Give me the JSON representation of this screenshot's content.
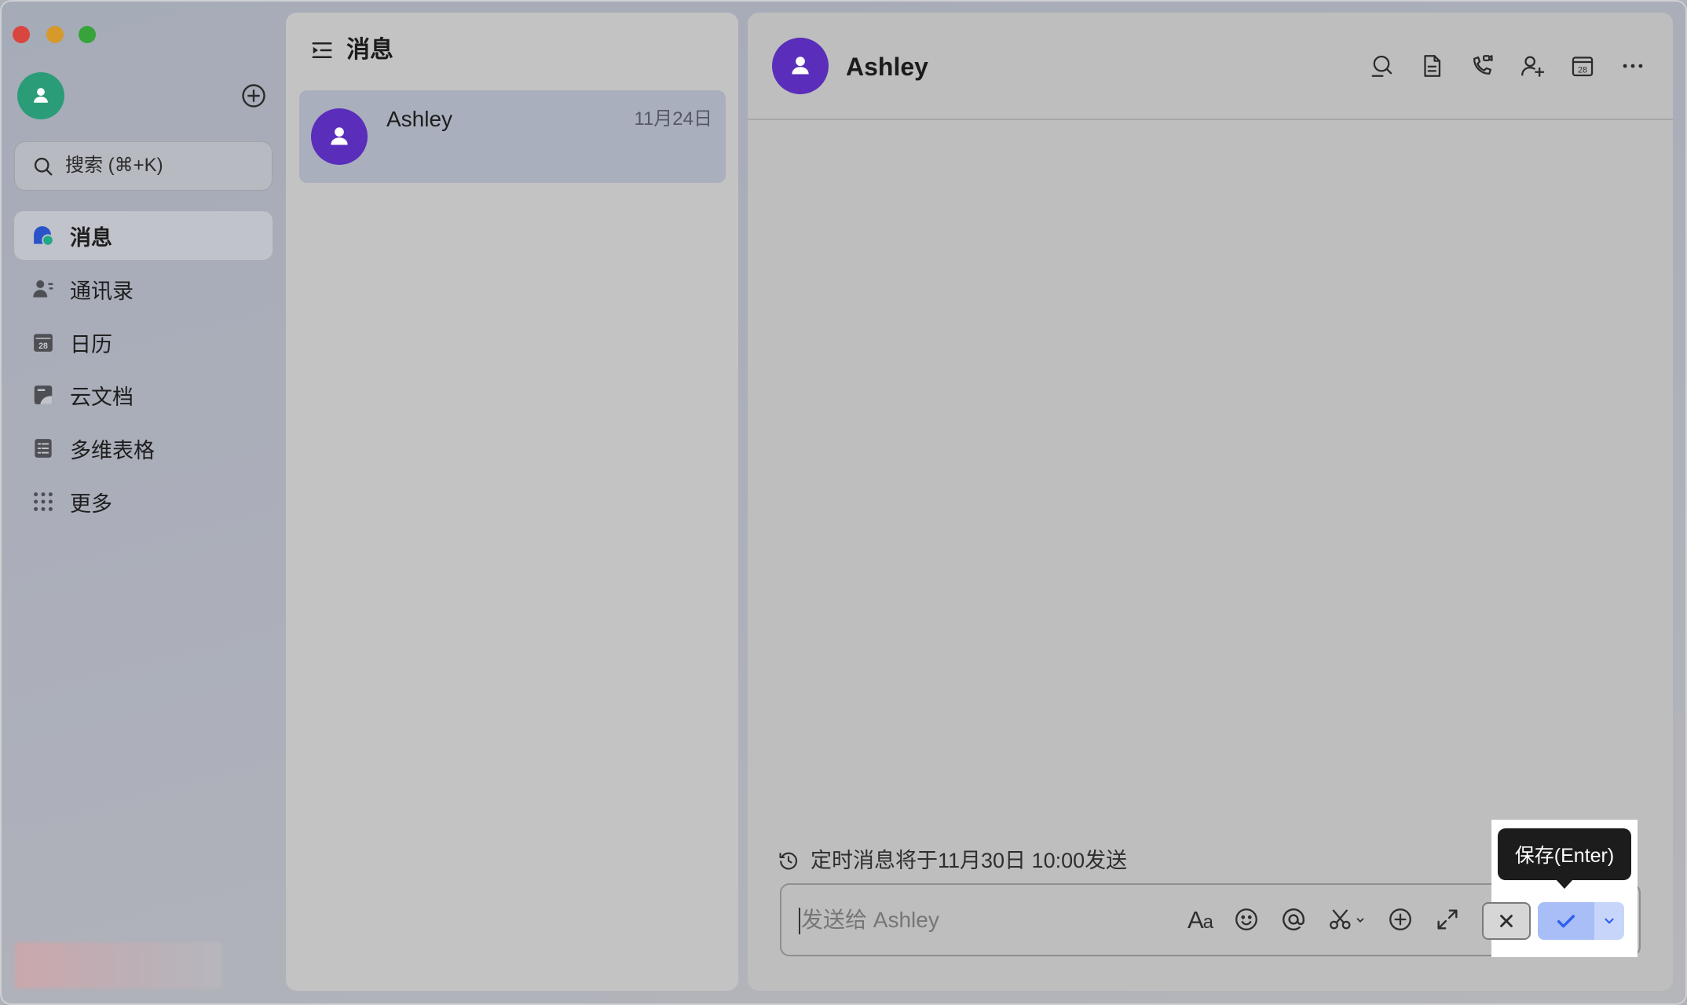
{
  "window": {
    "traffic_lights": {
      "close": "#d9463f",
      "minimize": "#d69a2a",
      "zoom": "#36a43a"
    }
  },
  "icons": {
    "calendar_day": "28"
  },
  "sidebar": {
    "avatar_color": "#2a9d78",
    "add_icon": "plus-circle-icon",
    "search": {
      "placeholder": "搜索 (⌘+K)",
      "icon": "search-icon"
    },
    "nav": [
      {
        "label": "消息",
        "icon": "message-icon",
        "selected": true
      },
      {
        "label": "通讯录",
        "icon": "contacts-icon"
      },
      {
        "label": "日历",
        "icon": "calendar-icon"
      },
      {
        "label": "云文档",
        "icon": "cloud-docs-icon"
      },
      {
        "label": "多维表格",
        "icon": "base-table-icon"
      },
      {
        "label": "更多",
        "icon": "more-apps-icon"
      }
    ]
  },
  "chat_list": {
    "title": "消息",
    "header_icon": "collapse-list-icon",
    "items": [
      {
        "name": "Ashley",
        "date": "11月24日",
        "selected": true,
        "avatar_color": "#5a2dba"
      }
    ]
  },
  "conversation": {
    "name": "Ashley",
    "avatar_color": "#5a2dba",
    "header_icons": [
      "chat-search-icon",
      "doc-icon",
      "call-icon",
      "add-member-icon",
      "calendar-icon",
      "more-icon"
    ],
    "scheduled_note": "定时消息将于11月30日 10:00发送",
    "composer": {
      "placeholder": "发送给 Ashley",
      "format_glyph": "Aa",
      "toolbar_icons": [
        "format-text-icon",
        "emoji-icon",
        "mention-icon",
        "scissors-icon",
        "add-circle-icon",
        "expand-icon"
      ],
      "cancel_icon": "close-icon",
      "save_icon": "check-icon",
      "save_options_icon": "chevron-down-icon"
    },
    "tooltip": "保存(Enter)"
  },
  "colors": {
    "accent": "#2f5fee",
    "accent_bg": "#a9bef7",
    "tooltip_bg": "#1c1c1c",
    "highlight": "#ffffff"
  }
}
